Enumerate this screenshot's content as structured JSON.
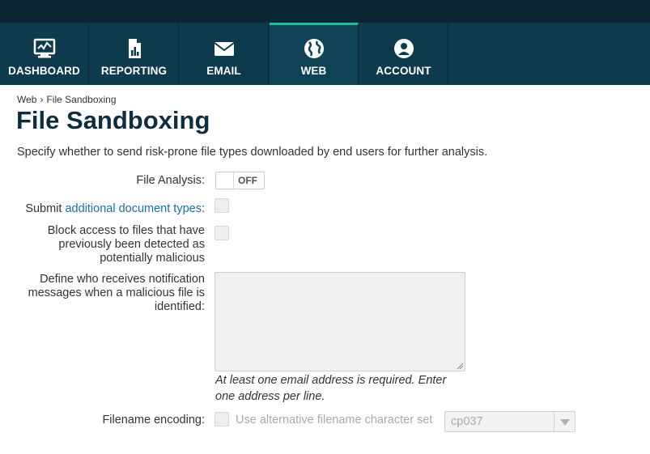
{
  "nav": {
    "tabs": [
      {
        "label": "DASHBOARD",
        "icon": "monitor-chart-icon"
      },
      {
        "label": "REPORTING",
        "icon": "report-document-icon"
      },
      {
        "label": "EMAIL",
        "icon": "envelope-icon"
      },
      {
        "label": "WEB",
        "icon": "globe-icon",
        "active": true
      },
      {
        "label": "ACCOUNT",
        "icon": "user-circle-icon"
      }
    ]
  },
  "breadcrumb": {
    "parent": "Web",
    "separator": "›",
    "current": "File Sandboxing"
  },
  "page": {
    "title": "File Sandboxing",
    "description": "Specify whether to send risk-prone file types downloaded by end users for further analysis."
  },
  "form": {
    "file_analysis": {
      "label": "File Analysis:",
      "state": "OFF"
    },
    "submit_types": {
      "prefix": "Submit ",
      "link": "additional document types",
      "suffix": ":"
    },
    "block_access": {
      "label": "Block access to files that have previously been detected as potentially malicious"
    },
    "notify": {
      "label": "Define who receives notification messages when a malicious file is identified:",
      "hint": "At least one email address is required. Enter one address per line."
    },
    "filename_encoding": {
      "label": "Filename encoding:",
      "alt_label": "Use alternative filename character set",
      "selected": "cp037"
    }
  },
  "colors": {
    "topbar": "#0b2633",
    "nav": "#0d3a4d",
    "active_accent": "#1abc9c",
    "title": "#0d2e3e",
    "link": "#1a6fa8"
  }
}
